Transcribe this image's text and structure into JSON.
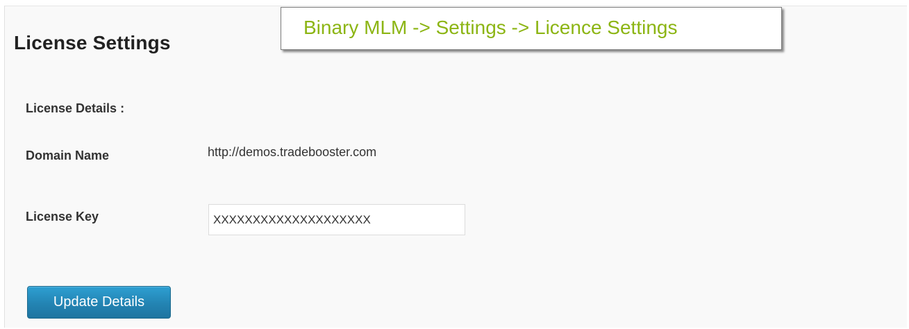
{
  "page": {
    "title": "License Settings"
  },
  "callout": {
    "breadcrumb": "Binary MLM -> Settings -> Licence Settings",
    "text_color": "#8cb514"
  },
  "form": {
    "section_heading": "License Details :",
    "domain_label": "Domain Name",
    "domain_value": "http://demos.tradebooster.com",
    "license_key_label": "License Key",
    "license_key_value": "XXXXXXXXXXXXXXXXXXXX"
  },
  "actions": {
    "update_label": "Update Details",
    "button_color": "#2384b3"
  }
}
